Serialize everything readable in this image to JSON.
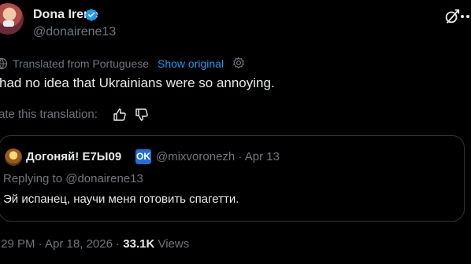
{
  "author": {
    "display_name": "Dona Irene",
    "handle": "@donairene13",
    "verified": true
  },
  "translation": {
    "source_label": "Translated from Portuguese",
    "show_original_label": "Show original",
    "text": "had no idea that Ukrainians were so annoying.",
    "rate_label": "ate this translation:"
  },
  "quote": {
    "display_name": "Догоняй! E7Ы09",
    "badge": "OK",
    "handle_date": "@mixvoronezh · Apr 13",
    "replying_to": "Replying to @donairene13",
    "text": "Эй испанец, научи меня готовить спагетти."
  },
  "meta": {
    "timestamp": ":29 PM · Apr 18, 2026 · ",
    "views_count": "33.1K",
    "views_label": " Views"
  },
  "icons": {
    "verified": "verified-badge-icon",
    "grok": "grok-icon",
    "more": "more-icon",
    "globe": "globe-icon",
    "gear": "gear-icon",
    "thumb_up": "thumb-up-icon",
    "thumb_down": "thumb-down-icon"
  },
  "colors": {
    "background": "#000000",
    "text_primary": "#e7e9ea",
    "text_secondary": "#71767b",
    "accent": "#1d9bf0",
    "border": "#2f3336",
    "ok_badge": "#1d6fd8"
  }
}
